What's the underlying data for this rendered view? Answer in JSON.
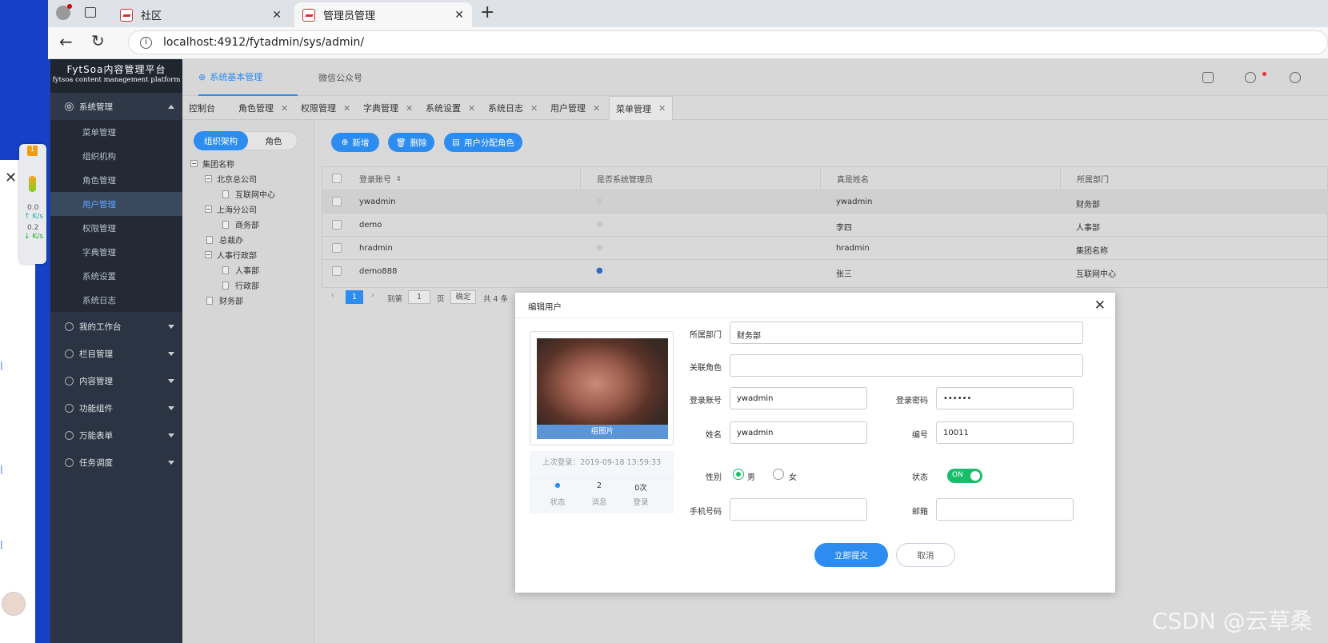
{
  "browser": {
    "tabs": [
      {
        "label": "社区"
      },
      {
        "label": "管理员管理"
      }
    ],
    "new_tab": "+",
    "url": "localhost:4912/fytadmin/sys/admin/"
  },
  "desktop": {
    "net": {
      "up": "0.0",
      "up_unit": "K/s",
      "down": "0.2",
      "down_unit": "K/s",
      "badge": "1"
    }
  },
  "app": {
    "logo_title": "FytSoa内容管理平台",
    "logo_sub": "fytsoa content management platform",
    "menu": {
      "system": "系统管理",
      "sub": [
        "菜单管理",
        "组织机构",
        "角色管理",
        "用户管理",
        "权限管理",
        "字典管理",
        "系统设置",
        "系统日志"
      ],
      "groups": [
        "我的工作台",
        "栏目管理",
        "内容管理",
        "功能组件",
        "万能表单",
        "任务调度"
      ]
    },
    "header_tabs": [
      "系统基本管理",
      "微信公众号"
    ],
    "page_tabs": [
      "控制台",
      "角色管理",
      "权限管理",
      "字典管理",
      "系统设置",
      "系统日志",
      "用户管理",
      "菜单管理"
    ],
    "tree": {
      "seg": [
        "组织架构",
        "角色"
      ],
      "nodes": [
        "集团名称",
        "北京总公司",
        "互联网中心",
        "上海分公司",
        "商务部",
        "总裁办",
        "人事行政部",
        "人事部",
        "行政部",
        "财务部"
      ]
    },
    "toolbar": {
      "add": "新增",
      "delete": "删除",
      "assign": "用户分配角色"
    },
    "grid": {
      "headers": [
        "登录账号",
        "是否系统管理员",
        "真是姓名",
        "所属部门"
      ],
      "rows": [
        {
          "account": "ywadmin",
          "name": "ywadmin",
          "dept": "财务部",
          "admin": false
        },
        {
          "account": "demo",
          "name": "李四",
          "dept": "人事部",
          "admin": false
        },
        {
          "account": "hradmin",
          "name": "hradmin",
          "dept": "集团名称",
          "admin": false
        },
        {
          "account": "demo888",
          "name": "张三",
          "dept": "互联网中心",
          "admin": true
        }
      ]
    },
    "pager": {
      "page": "1",
      "goto_prefix": "到第",
      "goto_value": "1",
      "goto_suffix": "页",
      "confirm": "确定",
      "total": "共 4 条"
    }
  },
  "modal": {
    "title": "编辑用户",
    "photo_caption": "组图片",
    "last_login": "上次登录：2019-09-18 13:59:33",
    "stats": [
      {
        "value": "●",
        "label": "状态"
      },
      {
        "value": "2",
        "label": "消息"
      },
      {
        "value": "0次",
        "label": "登录"
      }
    ],
    "labels": {
      "dept": "所属部门",
      "role": "关联角色",
      "account": "登录账号",
      "password": "登录密码",
      "name": "姓名",
      "number": "编号",
      "gender": "性别",
      "status": "状态",
      "phone": "手机号码",
      "email": "邮箱"
    },
    "values": {
      "dept": "财务部",
      "role": "",
      "account": "ywadmin",
      "password": "••••••",
      "name": "ywadmin",
      "number": "10011",
      "phone": "",
      "email": ""
    },
    "gender": {
      "male": "男",
      "female": "女",
      "selected": "男"
    },
    "status_toggle": "ON",
    "submit": "立即提交",
    "cancel": "取消"
  },
  "watermark": "CSDN @云草桑",
  "colors": {
    "accent": "#2d8cf0",
    "success": "#19be6b",
    "sidebar": "#2b3442"
  }
}
